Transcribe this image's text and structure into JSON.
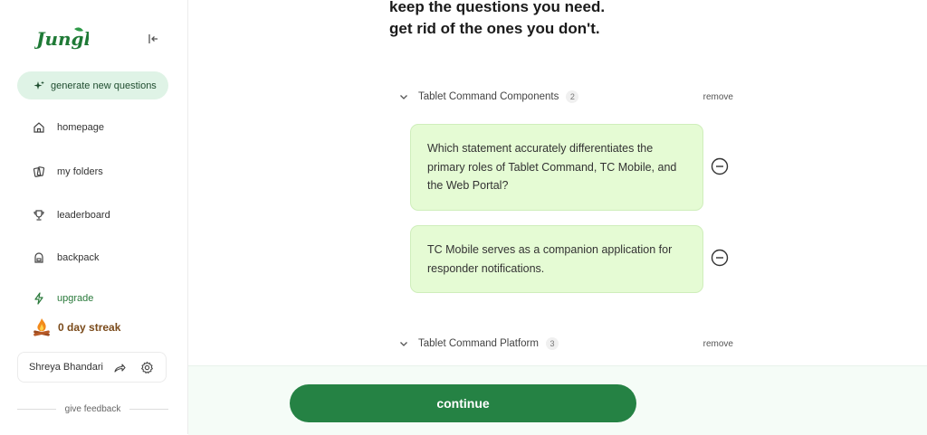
{
  "sidebar": {
    "logo_text": "Jungle",
    "generate_label": "generate new questions",
    "nav": [
      {
        "label": "homepage"
      },
      {
        "label": "my folders"
      },
      {
        "label": "leaderboard"
      },
      {
        "label": "backpack"
      },
      {
        "label": "upgrade"
      }
    ],
    "streak": "0 day streak",
    "user_name": "Shreya Bhandari",
    "feedback": "give feedback"
  },
  "main": {
    "heading_line1": "keep the questions you need.",
    "heading_line2": "get rid of the ones you don't.",
    "sections": [
      {
        "title": "Tablet Command Components",
        "count": "2",
        "remove": "remove",
        "questions": [
          "Which statement accurately differentiates the primary roles of Tablet Command, TC Mobile, and the Web Portal?",
          "TC Mobile serves as a companion application for responder notifications."
        ]
      },
      {
        "title": "Tablet Command Platform",
        "count": "3",
        "remove": "remove"
      }
    ]
  },
  "footer": {
    "continue_label": "continue"
  },
  "colors": {
    "accent": "#258244",
    "card_bg": "#e5fbd4",
    "generate_bg": "#dff3e6"
  }
}
